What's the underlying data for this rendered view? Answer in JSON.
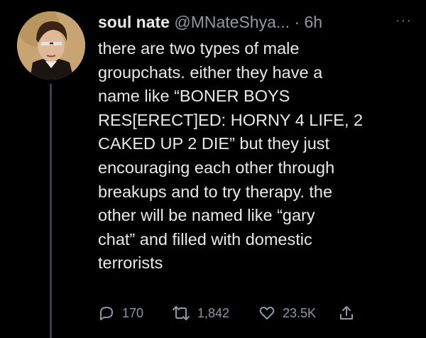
{
  "tweet": {
    "display_name": "soul nate",
    "handle": "@MNateShya...",
    "separator": "·",
    "time": "6h",
    "more": "···",
    "lines": [
      "there are two types of male",
      "groupchats. either they have a",
      "name like “BONER BOYS",
      "RES[ERECT]ED: HORNY 4 LIFE, 2",
      "CAKED UP 2 DIE” but they just",
      "encouraging each other through",
      "breakups and to try therapy. the",
      "other will be named like “gary",
      "chat” and filled with domestic",
      "terrorists"
    ],
    "actions": {
      "reply_count": "170",
      "retweet_count": "1,842",
      "like_count": "23.5K"
    }
  },
  "icons": {
    "reply": "reply-icon",
    "retweet": "retweet-icon",
    "like": "heart-icon",
    "share": "share-icon",
    "more": "more-icon"
  },
  "colors": {
    "background": "#000000",
    "text": "#e7e9ea",
    "secondary": "#8b98a5",
    "thread_line": "#3a3f44"
  }
}
